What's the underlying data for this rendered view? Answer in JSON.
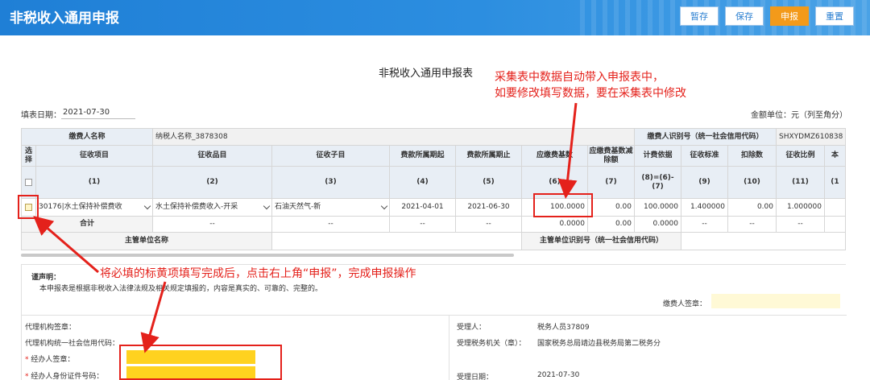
{
  "app": {
    "title": "非税收入通用申报",
    "buttons": [
      "暂存",
      "保存",
      "申报",
      "重置"
    ]
  },
  "form": {
    "title": "非税收入通用申报表",
    "date_label": "填表日期：",
    "date_value": "2021-07-30",
    "unit_label": "金额单位：元（列至角分）"
  },
  "annotations": {
    "top_line1": "采集表中数据自动带入申报表中，",
    "top_line2": "如要修改填写数据，要在采集表中修改",
    "middle": "将必填的标黄项填写完成后，点击右上角“申报”，完成申报操作"
  },
  "payer": {
    "name_label": "缴费人名称",
    "name_value": "纳税人名称_3878308",
    "id_label": "缴费人识别号（统一社会信用代码）",
    "id_value": "SHXYDMZ610838"
  },
  "table": {
    "headers": [
      "选择",
      "征收项目",
      "征收品目",
      "征收子目",
      "费款所属期起",
      "费款所属期止",
      "应缴费基数",
      "应缴费基数减除额",
      "计费依据",
      "征收标准",
      "扣除数",
      "征收比例",
      "本"
    ],
    "col_nums": [
      "",
      "(1)",
      "(2)",
      "(3)",
      "(4)",
      "(5)",
      "(6)",
      "(7)",
      "(8)=(6)-(7)",
      "(9)",
      "(10)",
      "(11)",
      "(1"
    ],
    "row": {
      "item": "30176|水土保持补偿费收",
      "subitem": "水土保持补偿费收入-开采",
      "subdetail": "石油天然气-新",
      "start": "2021-04-01",
      "end": "2021-06-30",
      "base": "100.0000",
      "deduct_base": "0.00",
      "basis": "100.0000",
      "standard": "1.400000",
      "deduct": "0.00",
      "ratio": "1.000000"
    },
    "total": {
      "label": "合计",
      "dash": "--",
      "base": "0.0000",
      "deduct_base": "0.00",
      "basis": "0.0000"
    },
    "supervisor_name_label": "主管单位名称",
    "supervisor_id_label": "主管单位识别号（统一社会信用代码）"
  },
  "declaration": {
    "title": "谨声明：",
    "text": "本申报表是根据非税收入法律法规及相关规定填报的，内容是真实的、可靠的、完整的。",
    "payer_sign": "缴费人签章：",
    "agency_seal": "代理机构签章：",
    "agency_code": "代理机构统一社会信用代码：",
    "handler_sign": "经办人签章：",
    "handler_id": "经办人身份证件号码：",
    "required_mark": "*",
    "receiver_label": "受理人：",
    "receiver_value": "税务人员37809",
    "authority_label": "受理税务机关（章）：",
    "authority_value": "国家税务总局靖边县税务局第二税务分",
    "receive_date_label": "受理日期：",
    "receive_date_value": "2021-07-30"
  },
  "colors": {
    "header_blue": "#2a86dc",
    "accent_orange": "#f39a1a",
    "annotation_red": "#e4211b",
    "required_yellow": "#ffd21f"
  }
}
